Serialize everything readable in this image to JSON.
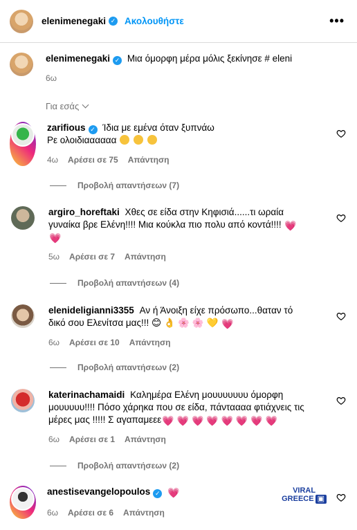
{
  "header": {
    "username": "elenimenegaki",
    "follow_label": "Ακολουθήστε",
    "more_icon": "more-dots-icon"
  },
  "caption": {
    "username": "elenimenegaki",
    "text": "Μια όμορφη μέρα μόλις ξεκίνησε # eleni",
    "time": "6ω"
  },
  "filter": {
    "label": "Για εσάς"
  },
  "comments": [
    {
      "username": "zarifious",
      "verified": true,
      "text": "Ίδια με εμένα όταν ξυπνάω Ρε ολοιδιαααααα 😂 😂 😂",
      "time": "4ω",
      "likes": "Αρέσει σε 75",
      "reply": "Απάντηση",
      "view_replies": "Προβολή απαντήσεων (7)"
    },
    {
      "username": "argiro_horeftaki",
      "verified": false,
      "text": "Χθες σε είδα στην Κηφισιά......τι ωραία γυναίκα βρε Ελένη!!!! Μια κούκλα πιο πολυ από κοντά!!!! 💗 💗",
      "time": "5ω",
      "likes": "Αρέσει σε 7",
      "reply": "Απάντηση",
      "view_replies": "Προβολή απαντήσεων (4)"
    },
    {
      "username": "elenideligianni3355",
      "verified": false,
      "text": "Αν ή Άνοιξη είχε πρόσωπο...θαταν τό δικό σου Ελενίτσα μας!!! 😊 👌 🌸 🌸 💛 💗",
      "time": "6ω",
      "likes": "Αρέσει σε 10",
      "reply": "Απάντηση",
      "view_replies": "Προβολή απαντήσεων (2)"
    },
    {
      "username": "katerinachamaidi",
      "verified": false,
      "text": "Καλημέρα Ελένη μουυυυυυυ όμορφη μουυυυυ!!!! Πόσο χάρηκα που σε είδα, πάνταααα φτιάχνεις τις μέρες μας !!!!! Σ αγαπαμεεε💗 💗 💗 💗 💗 💗 💗 💗",
      "time": "6ω",
      "likes": "Αρέσει σε 1",
      "reply": "Απάντηση",
      "view_replies": "Προβολή απαντήσεων (2)"
    },
    {
      "username": "anestisevangelopoulos",
      "verified": true,
      "text": "💗",
      "time": "6ω",
      "likes": "Αρέσει σε 6",
      "reply": "Απάντηση"
    }
  ],
  "watermark": {
    "line1": "VIRAL",
    "line2": "GREECE"
  }
}
